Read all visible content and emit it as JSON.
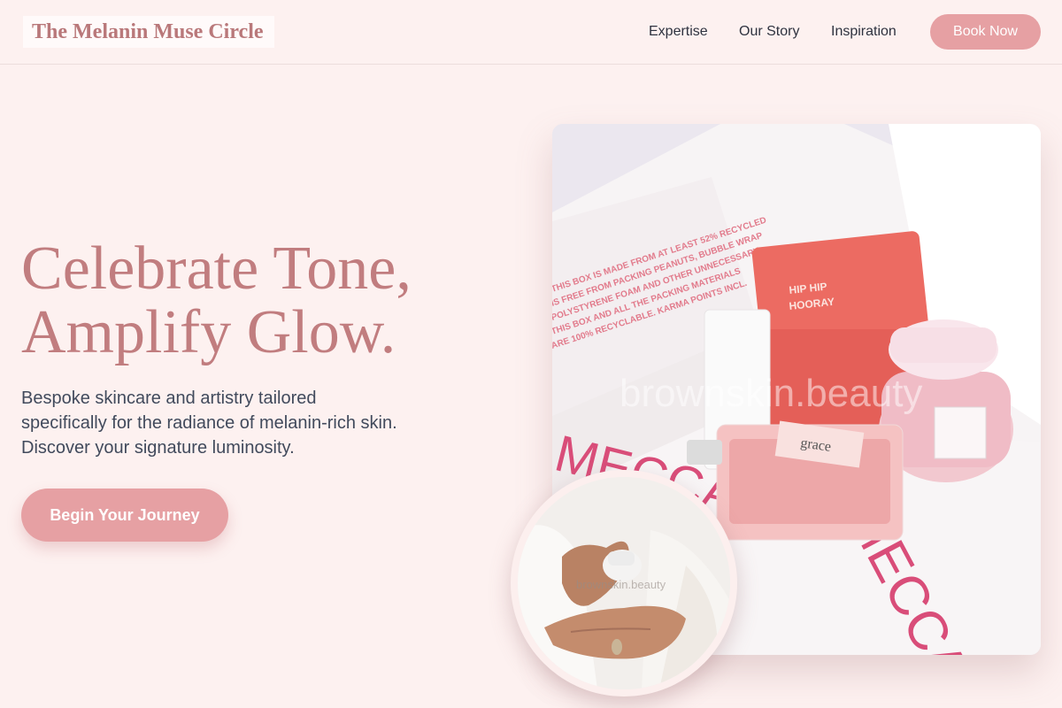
{
  "header": {
    "logo": "The Melanin Muse Circle",
    "nav": [
      {
        "label": "Expertise"
      },
      {
        "label": "Our Story"
      },
      {
        "label": "Inspiration"
      }
    ],
    "book_label": "Book Now"
  },
  "hero": {
    "title_line1": "Celebrate Tone,",
    "title_line2": "Amplify Glow.",
    "subtitle": "Bespoke skincare and artistry tailored specifically for the radiance of melanin-rich skin. Discover your signature luminosity.",
    "cta_label": "Begin Your Journey"
  },
  "main_photo": {
    "watermark": "brownskin.beauty",
    "box_text": "MECCA",
    "jar_label": "HIP HIP HOORAY",
    "bottle_label": "grace"
  },
  "circle_photo": {
    "watermark": "brownskin.beauty"
  },
  "colors": {
    "accent": "#e6a0a3",
    "title": "#c17d7f",
    "background": "#fdf1f0"
  }
}
